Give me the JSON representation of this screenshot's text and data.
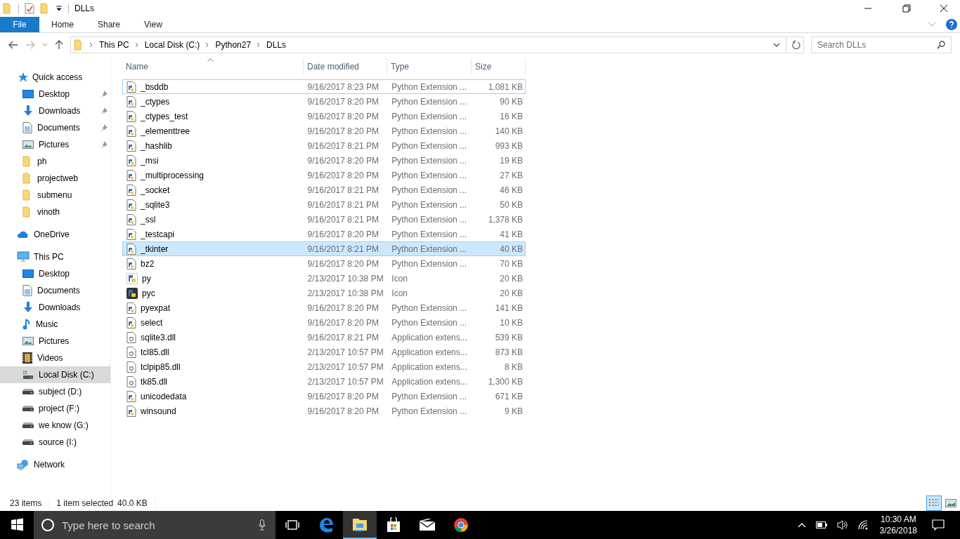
{
  "window": {
    "title": "DLLs"
  },
  "ribbon": {
    "tabs": [
      {
        "label": "File",
        "selected": true
      },
      {
        "label": "Home",
        "selected": false
      },
      {
        "label": "Share",
        "selected": false
      },
      {
        "label": "View",
        "selected": false
      }
    ]
  },
  "address": {
    "crumbs": [
      "This PC",
      "Local Disk (C:)",
      "Python27",
      "DLLs"
    ]
  },
  "search": {
    "placeholder": "Search DLLs"
  },
  "sidebar": {
    "items": [
      {
        "label": "Quick access",
        "kind": "star",
        "selected": false,
        "children": [
          {
            "label": "Desktop",
            "kind": "desktop",
            "pinned": true,
            "selected": false
          },
          {
            "label": "Downloads",
            "kind": "download",
            "pinned": true,
            "selected": false
          },
          {
            "label": "Documents",
            "kind": "document",
            "pinned": true,
            "selected": false
          },
          {
            "label": "Pictures",
            "kind": "pictures",
            "pinned": true,
            "selected": false
          },
          {
            "label": "ph",
            "kind": "folder",
            "pinned": false,
            "selected": false
          },
          {
            "label": "projectweb",
            "kind": "folder",
            "pinned": false,
            "selected": false
          },
          {
            "label": "submenu",
            "kind": "folder",
            "pinned": false,
            "selected": false
          },
          {
            "label": "vinoth",
            "kind": "folder",
            "pinned": false,
            "selected": false
          }
        ]
      },
      {
        "label": "OneDrive",
        "kind": "cloud",
        "selected": false
      },
      {
        "label": "This PC",
        "kind": "pc",
        "selected": false,
        "children": [
          {
            "label": "Desktop",
            "kind": "desktop",
            "pinned": false,
            "selected": false
          },
          {
            "label": "Documents",
            "kind": "document",
            "pinned": false,
            "selected": false
          },
          {
            "label": "Downloads",
            "kind": "download",
            "pinned": false,
            "selected": false
          },
          {
            "label": "Music",
            "kind": "music",
            "pinned": false,
            "selected": false
          },
          {
            "label": "Pictures",
            "kind": "pictures",
            "pinned": false,
            "selected": false
          },
          {
            "label": "Videos",
            "kind": "videos",
            "pinned": false,
            "selected": false
          },
          {
            "label": "Local Disk (C:)",
            "kind": "windrive",
            "pinned": false,
            "selected": true
          },
          {
            "label": "subject (D:)",
            "kind": "drive",
            "pinned": false,
            "selected": false
          },
          {
            "label": "project (F:)",
            "kind": "drive",
            "pinned": false,
            "selected": false
          },
          {
            "label": "we know (G:)",
            "kind": "drive",
            "pinned": false,
            "selected": false
          },
          {
            "label": "source (I:)",
            "kind": "drive",
            "pinned": false,
            "selected": false
          }
        ]
      },
      {
        "label": "Network",
        "kind": "network",
        "selected": false
      }
    ]
  },
  "table": {
    "columns": [
      {
        "label": "Name",
        "sorted": true
      },
      {
        "label": "Date modified",
        "sorted": false
      },
      {
        "label": "Type",
        "sorted": false
      },
      {
        "label": "Size",
        "sorted": false
      }
    ],
    "rows": [
      {
        "kind": "pyd",
        "name": "_bsddb",
        "date": "9/16/2017 8:23 PM",
        "type": "Python Extension ...",
        "size": "1,081 KB",
        "selected": false,
        "focused": true
      },
      {
        "kind": "pyd",
        "name": "_ctypes",
        "date": "9/16/2017 8:20 PM",
        "type": "Python Extension ...",
        "size": "90 KB",
        "selected": false,
        "focused": false
      },
      {
        "kind": "pyd",
        "name": "_ctypes_test",
        "date": "9/16/2017 8:20 PM",
        "type": "Python Extension ...",
        "size": "16 KB",
        "selected": false,
        "focused": false
      },
      {
        "kind": "pyd",
        "name": "_elementtree",
        "date": "9/16/2017 8:20 PM",
        "type": "Python Extension ...",
        "size": "140 KB",
        "selected": false,
        "focused": false
      },
      {
        "kind": "pyd",
        "name": "_hashlib",
        "date": "9/16/2017 8:21 PM",
        "type": "Python Extension ...",
        "size": "993 KB",
        "selected": false,
        "focused": false
      },
      {
        "kind": "pyd",
        "name": "_msi",
        "date": "9/16/2017 8:20 PM",
        "type": "Python Extension ...",
        "size": "19 KB",
        "selected": false,
        "focused": false
      },
      {
        "kind": "pyd",
        "name": "_multiprocessing",
        "date": "9/16/2017 8:20 PM",
        "type": "Python Extension ...",
        "size": "27 KB",
        "selected": false,
        "focused": false
      },
      {
        "kind": "pyd",
        "name": "_socket",
        "date": "9/16/2017 8:21 PM",
        "type": "Python Extension ...",
        "size": "46 KB",
        "selected": false,
        "focused": false
      },
      {
        "kind": "pyd",
        "name": "_sqlite3",
        "date": "9/16/2017 8:21 PM",
        "type": "Python Extension ...",
        "size": "50 KB",
        "selected": false,
        "focused": false
      },
      {
        "kind": "pyd",
        "name": "_ssl",
        "date": "9/16/2017 8:21 PM",
        "type": "Python Extension ...",
        "size": "1,378 KB",
        "selected": false,
        "focused": false
      },
      {
        "kind": "pyd",
        "name": "_testcapi",
        "date": "9/16/2017 8:20 PM",
        "type": "Python Extension ...",
        "size": "41 KB",
        "selected": false,
        "focused": false
      },
      {
        "kind": "pyd",
        "name": "_tkinter",
        "date": "9/16/2017 8:21 PM",
        "type": "Python Extension ...",
        "size": "40 KB",
        "selected": true,
        "focused": false
      },
      {
        "kind": "pyd",
        "name": "bz2",
        "date": "9/16/2017 8:20 PM",
        "type": "Python Extension ...",
        "size": "70 KB",
        "selected": false,
        "focused": false
      },
      {
        "kind": "ico-light",
        "name": "py",
        "date": "2/13/2017 10:38 PM",
        "type": "Icon",
        "size": "20 KB",
        "selected": false,
        "focused": false
      },
      {
        "kind": "ico-dark",
        "name": "pyc",
        "date": "2/13/2017 10:38 PM",
        "type": "Icon",
        "size": "20 KB",
        "selected": false,
        "focused": false
      },
      {
        "kind": "pyd",
        "name": "pyexpat",
        "date": "9/16/2017 8:20 PM",
        "type": "Python Extension ...",
        "size": "141 KB",
        "selected": false,
        "focused": false
      },
      {
        "kind": "pyd",
        "name": "select",
        "date": "9/16/2017 8:20 PM",
        "type": "Python Extension ...",
        "size": "10 KB",
        "selected": false,
        "focused": false
      },
      {
        "kind": "dll",
        "name": "sqlite3.dll",
        "date": "9/16/2017 8:21 PM",
        "type": "Application extens...",
        "size": "539 KB",
        "selected": false,
        "focused": false
      },
      {
        "kind": "dll",
        "name": "tcl85.dll",
        "date": "2/13/2017 10:57 PM",
        "type": "Application extens...",
        "size": "873 KB",
        "selected": false,
        "focused": false
      },
      {
        "kind": "dll",
        "name": "tclpip85.dll",
        "date": "2/13/2017 10:57 PM",
        "type": "Application extens...",
        "size": "8 KB",
        "selected": false,
        "focused": false
      },
      {
        "kind": "dll",
        "name": "tk85.dll",
        "date": "2/13/2017 10:57 PM",
        "type": "Application extens...",
        "size": "1,300 KB",
        "selected": false,
        "focused": false
      },
      {
        "kind": "pyd",
        "name": "unicodedata",
        "date": "9/16/2017 8:20 PM",
        "type": "Python Extension ...",
        "size": "671 KB",
        "selected": false,
        "focused": false
      },
      {
        "kind": "pyd",
        "name": "winsound",
        "date": "9/16/2017 8:20 PM",
        "type": "Python Extension ...",
        "size": "9 KB",
        "selected": false,
        "focused": false
      }
    ]
  },
  "status_bar": {
    "count": "23 items",
    "selection": "1 item selected",
    "selection_size": "40.0 KB"
  },
  "views": [
    {
      "kind": "details",
      "selected": true
    },
    {
      "kind": "large-icons",
      "selected": false
    }
  ],
  "taskbar": {
    "search_placeholder": "Type here to search",
    "apps": [
      {
        "kind": "task-view",
        "active": false
      },
      {
        "kind": "edge",
        "active": false
      },
      {
        "kind": "explorer",
        "active": true
      },
      {
        "kind": "store",
        "active": false
      },
      {
        "kind": "mail",
        "active": false
      },
      {
        "kind": "chrome",
        "active": false
      }
    ],
    "time": "10:30 AM",
    "date": "3/26/2018"
  }
}
